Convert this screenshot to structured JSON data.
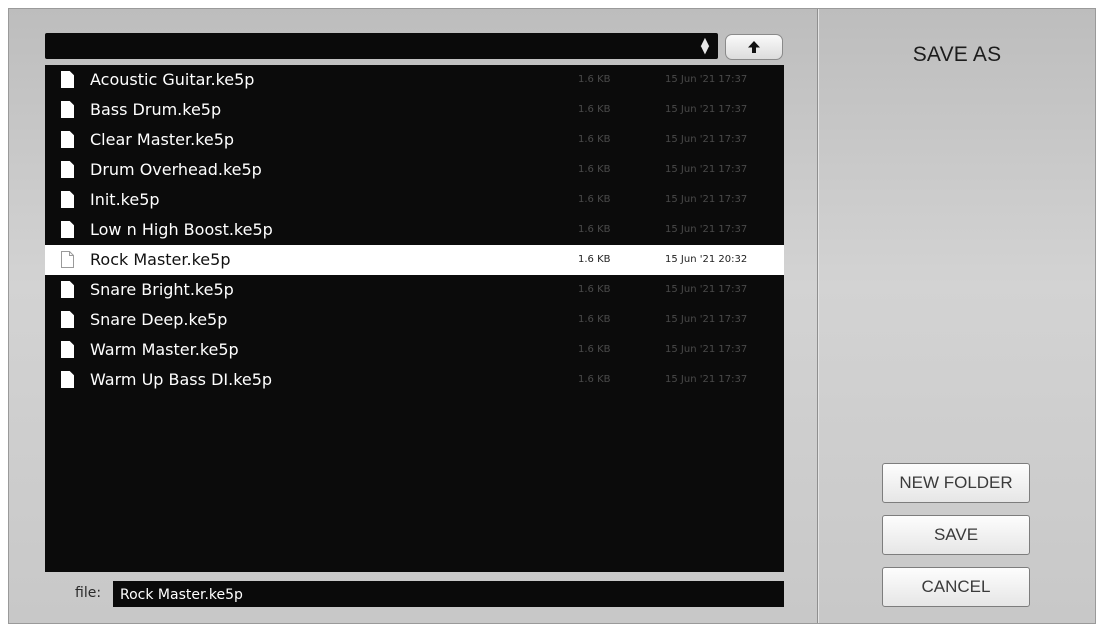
{
  "dialog": {
    "title": "SAVE AS"
  },
  "toolbar": {
    "path_value": ""
  },
  "files": [
    {
      "name": "Acoustic Guitar.ke5p",
      "size": "1.6 KB",
      "date": "15 Jun '21 17:37",
      "selected": false
    },
    {
      "name": "Bass Drum.ke5p",
      "size": "1.6 KB",
      "date": "15 Jun '21 17:37",
      "selected": false
    },
    {
      "name": "Clear Master.ke5p",
      "size": "1.6 KB",
      "date": "15 Jun '21 17:37",
      "selected": false
    },
    {
      "name": "Drum Overhead.ke5p",
      "size": "1.6 KB",
      "date": "15 Jun '21 17:37",
      "selected": false
    },
    {
      "name": "Init.ke5p",
      "size": "1.6 KB",
      "date": "15 Jun '21 17:37",
      "selected": false
    },
    {
      "name": "Low n High Boost.ke5p",
      "size": "1.6 KB",
      "date": "15 Jun '21 17:37",
      "selected": false
    },
    {
      "name": "Rock Master.ke5p",
      "size": "1.6 KB",
      "date": "15 Jun '21 20:32",
      "selected": true
    },
    {
      "name": "Snare Bright.ke5p",
      "size": "1.6 KB",
      "date": "15 Jun '21 17:37",
      "selected": false
    },
    {
      "name": "Snare Deep.ke5p",
      "size": "1.6 KB",
      "date": "15 Jun '21 17:37",
      "selected": false
    },
    {
      "name": "Warm Master.ke5p",
      "size": "1.6 KB",
      "date": "15 Jun '21 17:37",
      "selected": false
    },
    {
      "name": "Warm Up Bass DI.ke5p",
      "size": "1.6 KB",
      "date": "15 Jun '21 17:37",
      "selected": false
    }
  ],
  "file_field": {
    "label": "file:",
    "value": "Rock Master.ke5p"
  },
  "buttons": {
    "new_folder": "NEW FOLDER",
    "save": "SAVE",
    "cancel": "CANCEL"
  },
  "icons": {
    "up": "up-arrow-icon",
    "sort": "sort-arrows-icon",
    "file": "document-icon"
  },
  "colors": {
    "list_background": "#0b0b0b",
    "selected_row": "#ffffff",
    "panel": "#c9c9c9"
  }
}
